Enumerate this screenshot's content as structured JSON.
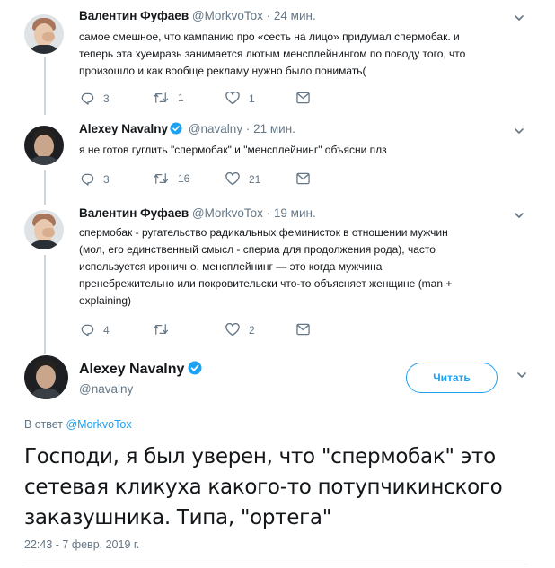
{
  "tweets": [
    {
      "name": "Валентин Фуфаев",
      "handle": "@MorkvoTox",
      "dot": "·",
      "time": "24 мин.",
      "text": "самое смешное, что кампанию про «сесть на лицо» придумал спермобак. и\nтеперь эта хуемразь занимается лютым менсплейнингом по поводу того, что\nпроизошло и как вообще рекламу нужно было понимать(",
      "replies": "3",
      "retweets": "1",
      "likes": "1"
    },
    {
      "name": "Alexey Navalny",
      "handle": "@navalny",
      "dot": "·",
      "time": "21 мин.",
      "text": "я не готов гуглить \"спермобак\" и \"менсплейнинг\" объясни плз",
      "replies": "3",
      "retweets": "16",
      "likes": "21"
    },
    {
      "name": "Валентин Фуфаев",
      "handle": "@MorkvoTox",
      "dot": "·",
      "time": "19 мин.",
      "text": "спермобак - ругательство радикальных феминисток в отношении мужчин\n(мол, его единственный смысл - сперма для продолжения рода), часто\nиспользуется иронично. менсплейнинг — это когда мужчина\nпренебрежительно или покровительски что-то объясняет женщине (man +\nexplaining)",
      "replies": "4",
      "retweets": "",
      "likes": "2"
    }
  ],
  "main": {
    "name": "Alexey Navalny",
    "handle": "@navalny",
    "follow_label": "Читать",
    "reply_prefix": "В ответ ",
    "reply_to": "@MorkvoTox",
    "text": "Господи, я был уверен, что \"спермобак\" это сетевая кликуха какого-то потупчикинского заказушника. Типа, \"ортега\"",
    "timestamp": "22:43 - 7 февр. 2019 г."
  },
  "colors": {
    "accent": "#1da1f2",
    "muted": "#657786",
    "text": "#14171a",
    "divider": "#ccd6dd"
  },
  "icons": [
    "reply-icon",
    "retweet-icon",
    "like-icon",
    "dm-icon",
    "verified-icon",
    "caret-down-icon"
  ]
}
